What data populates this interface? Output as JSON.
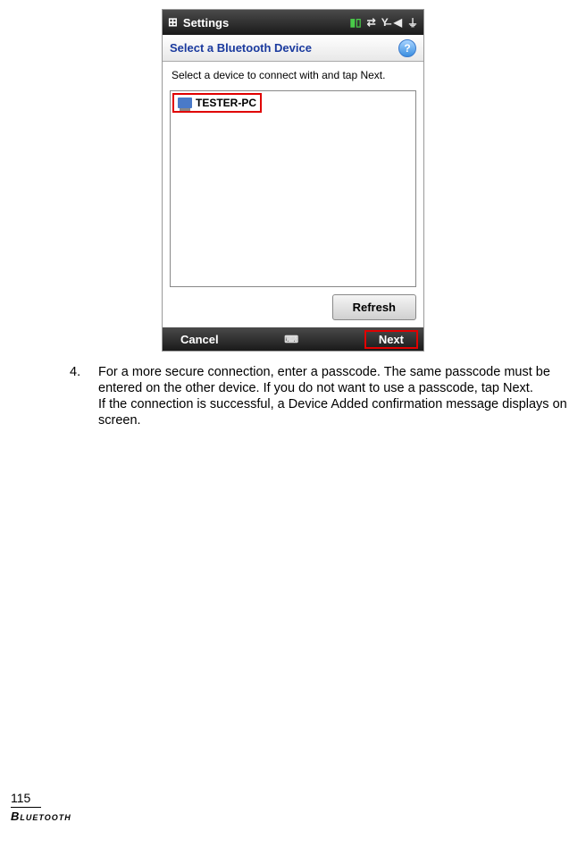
{
  "titlebar": {
    "start_icon": "⊞",
    "title": "Settings"
  },
  "header": {
    "title": "Select a Bluetooth Device",
    "help_label": "?"
  },
  "instruction": "Select a device to connect with and tap Next.",
  "device_list": {
    "items": [
      {
        "name": "TESTER-PC"
      }
    ]
  },
  "refresh": {
    "label": "Refresh"
  },
  "bottombar": {
    "cancel": "Cancel",
    "next": "Next"
  },
  "step": {
    "number": "4.",
    "text": "For a more secure connection, enter a passcode. The same passcode must be entered on the other device. If you do not want to use a passcode, tap Next.\nIf the connection is successful, a Device Added confirmation message displays on screen."
  },
  "footer": {
    "page": "115",
    "section": "Bluetooth"
  }
}
